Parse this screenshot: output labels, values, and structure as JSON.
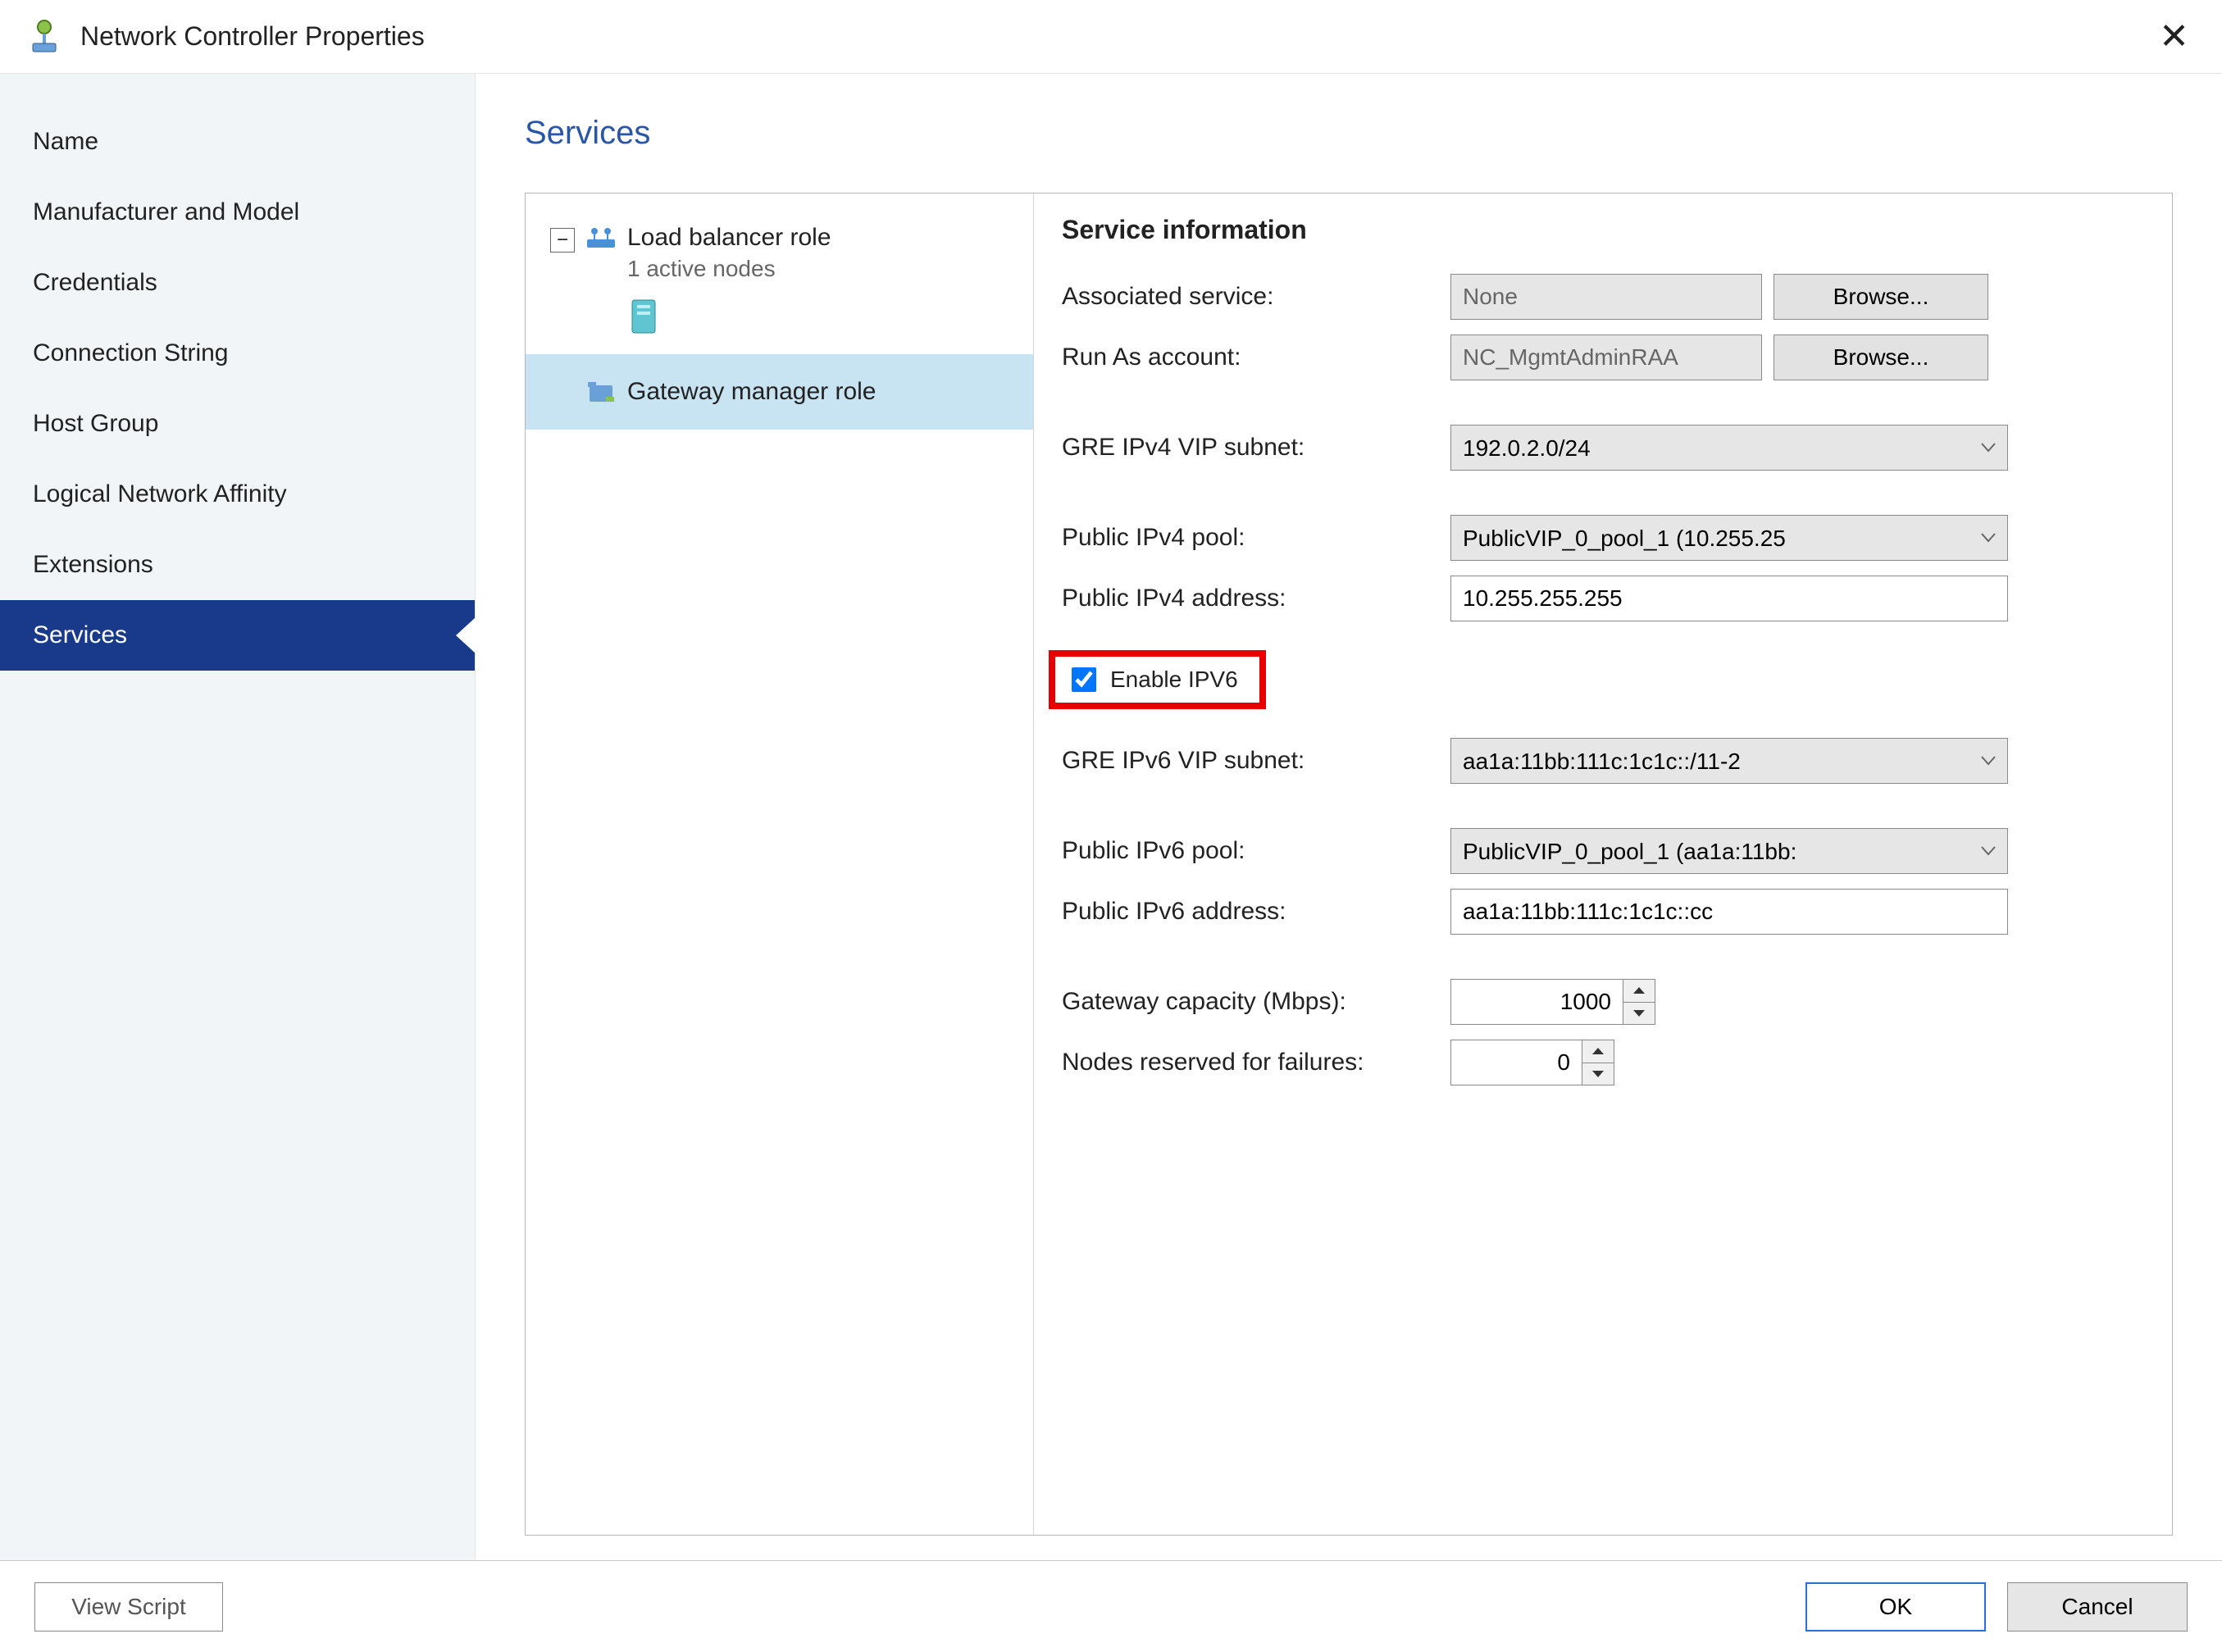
{
  "window": {
    "title": "Network Controller Properties"
  },
  "sidebar": {
    "items": [
      {
        "label": "Name"
      },
      {
        "label": "Manufacturer and Model"
      },
      {
        "label": "Credentials"
      },
      {
        "label": "Connection String"
      },
      {
        "label": "Host Group"
      },
      {
        "label": "Logical Network Affinity"
      },
      {
        "label": "Extensions"
      },
      {
        "label": "Services",
        "selected": true
      }
    ]
  },
  "main": {
    "title": "Services",
    "tree": {
      "load_balancer": {
        "label": "Load balancer role",
        "sub": "1 active nodes"
      },
      "gateway_manager": {
        "label": "Gateway manager role"
      }
    },
    "form": {
      "heading": "Service information",
      "associated_service": {
        "label": "Associated service:",
        "value": "None",
        "browse_label": "Browse..."
      },
      "run_as": {
        "label": "Run As account:",
        "value": "NC_MgmtAdminRAA",
        "browse_label": "Browse..."
      },
      "gre_ipv4": {
        "label": "GRE IPv4 VIP subnet:",
        "value": "192.0.2.0/24"
      },
      "public_ipv4_pool": {
        "label": "Public IPv4 pool:",
        "value": "PublicVIP_0_pool_1 (10.255.25"
      },
      "public_ipv4_addr": {
        "label": "Public IPv4 address:",
        "value": "10.255.255.255"
      },
      "enable_ipv6": {
        "label": "Enable IPV6",
        "checked": true
      },
      "gre_ipv6": {
        "label": "GRE IPv6 VIP subnet:",
        "value": "aa1a:11bb:111c:1c1c::/11-2"
      },
      "public_ipv6_pool": {
        "label": "Public IPv6 pool:",
        "value": "PublicVIP_0_pool_1 (aa1a:11bb:"
      },
      "public_ipv6_addr": {
        "label": "Public IPv6 address:",
        "value": "aa1a:11bb:111c:1c1c::cc"
      },
      "gateway_capacity": {
        "label": "Gateway capacity (Mbps):",
        "value": "1000"
      },
      "nodes_reserved": {
        "label": "Nodes reserved for failures:",
        "value": "0"
      }
    }
  },
  "footer": {
    "view_script": "View Script",
    "ok": "OK",
    "cancel": "Cancel"
  }
}
